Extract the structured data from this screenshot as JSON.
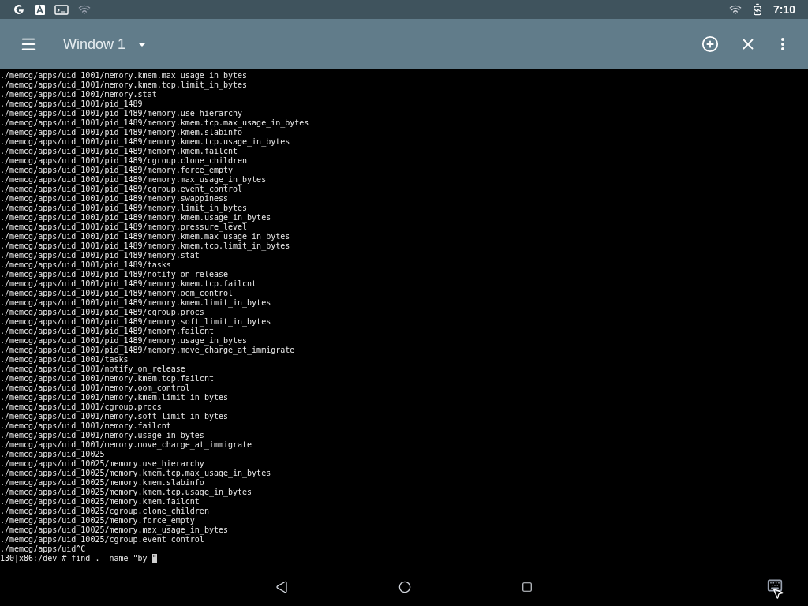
{
  "status_bar": {
    "time": "7:10"
  },
  "toolbar": {
    "window_title": "Window 1"
  },
  "terminal": {
    "lines": [
      "./memcg/apps/uid_1001/memory.kmem.max_usage_in_bytes",
      "./memcg/apps/uid_1001/memory.kmem.tcp.limit_in_bytes",
      "./memcg/apps/uid_1001/memory.stat",
      "./memcg/apps/uid_1001/pid_1489",
      "./memcg/apps/uid_1001/pid_1489/memory.use_hierarchy",
      "./memcg/apps/uid_1001/pid_1489/memory.kmem.tcp.max_usage_in_bytes",
      "./memcg/apps/uid_1001/pid_1489/memory.kmem.slabinfo",
      "./memcg/apps/uid_1001/pid_1489/memory.kmem.tcp.usage_in_bytes",
      "./memcg/apps/uid_1001/pid_1489/memory.kmem.failcnt",
      "./memcg/apps/uid_1001/pid_1489/cgroup.clone_children",
      "./memcg/apps/uid_1001/pid_1489/memory.force_empty",
      "./memcg/apps/uid_1001/pid_1489/memory.max_usage_in_bytes",
      "./memcg/apps/uid_1001/pid_1489/cgroup.event_control",
      "./memcg/apps/uid_1001/pid_1489/memory.swappiness",
      "./memcg/apps/uid_1001/pid_1489/memory.limit_in_bytes",
      "./memcg/apps/uid_1001/pid_1489/memory.kmem.usage_in_bytes",
      "./memcg/apps/uid_1001/pid_1489/memory.pressure_level",
      "./memcg/apps/uid_1001/pid_1489/memory.kmem.max_usage_in_bytes",
      "./memcg/apps/uid_1001/pid_1489/memory.kmem.tcp.limit_in_bytes",
      "./memcg/apps/uid_1001/pid_1489/memory.stat",
      "./memcg/apps/uid_1001/pid_1489/tasks",
      "./memcg/apps/uid_1001/pid_1489/notify_on_release",
      "./memcg/apps/uid_1001/pid_1489/memory.kmem.tcp.failcnt",
      "./memcg/apps/uid_1001/pid_1489/memory.oom_control",
      "./memcg/apps/uid_1001/pid_1489/memory.kmem.limit_in_bytes",
      "./memcg/apps/uid_1001/pid_1489/cgroup.procs",
      "./memcg/apps/uid_1001/pid_1489/memory.soft_limit_in_bytes",
      "./memcg/apps/uid_1001/pid_1489/memory.failcnt",
      "./memcg/apps/uid_1001/pid_1489/memory.usage_in_bytes",
      "./memcg/apps/uid_1001/pid_1489/memory.move_charge_at_immigrate",
      "./memcg/apps/uid_1001/tasks",
      "./memcg/apps/uid_1001/notify_on_release",
      "./memcg/apps/uid_1001/memory.kmem.tcp.failcnt",
      "./memcg/apps/uid_1001/memory.oom_control",
      "./memcg/apps/uid_1001/memory.kmem.limit_in_bytes",
      "./memcg/apps/uid_1001/cgroup.procs",
      "./memcg/apps/uid_1001/memory.soft_limit_in_bytes",
      "./memcg/apps/uid_1001/memory.failcnt",
      "./memcg/apps/uid_1001/memory.usage_in_bytes",
      "./memcg/apps/uid_1001/memory.move_charge_at_immigrate",
      "./memcg/apps/uid_10025",
      "./memcg/apps/uid_10025/memory.use_hierarchy",
      "./memcg/apps/uid_10025/memory.kmem.tcp.max_usage_in_bytes",
      "./memcg/apps/uid_10025/memory.kmem.slabinfo",
      "./memcg/apps/uid_10025/memory.kmem.tcp.usage_in_bytes",
      "./memcg/apps/uid_10025/memory.kmem.failcnt",
      "./memcg/apps/uid_10025/cgroup.clone_children",
      "./memcg/apps/uid_10025/memory.force_empty",
      "./memcg/apps/uid_10025/memory.max_usage_in_bytes",
      "./memcg/apps/uid_10025/cgroup.event_control",
      "./memcg/apps/uid^C"
    ],
    "prompt": "130|x86:/dev # find . -name \"by-",
    "cursor_char": "\""
  }
}
